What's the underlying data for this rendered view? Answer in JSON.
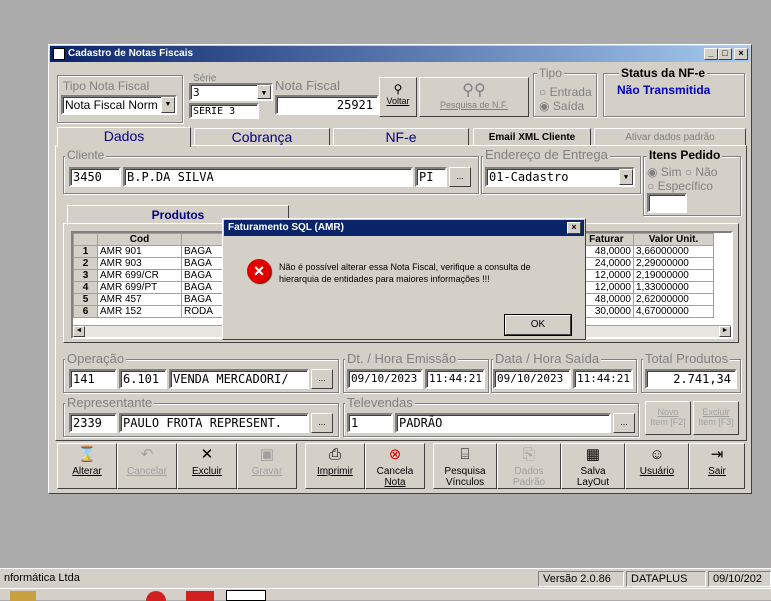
{
  "window": {
    "title": "Cadastro de Notas Fiscais"
  },
  "header": {
    "tipo_label": "Tipo Nota Fiscal",
    "tipo_value": "Nota Fiscal Norm",
    "serie_label": "Série",
    "serie_value": "3",
    "serie_text": "SÉRIE 3",
    "nota_label": "Nota Fiscal",
    "nota_value": "25921",
    "voltar_label": "Voltar",
    "pesquisa_label": "Pesquisa de N.F.",
    "tipo_group_label": "Tipo",
    "entrada_label": "Entrada",
    "saida_label": "Saída",
    "status_label": "Status da NF-e",
    "status_value": "Não Transmitida"
  },
  "tabs": {
    "dados": "Dados",
    "cobranca": "Cobrança",
    "nfe": "NF-e",
    "email": "Email XML Cliente",
    "ativar": "Ativar dados padrão"
  },
  "cliente": {
    "label": "Cliente",
    "code": "3450",
    "name": "B.P.DA SILVA",
    "uf": "PI",
    "ellipsis": "...",
    "endereco_label": "Endereço de Entrega",
    "endereco_value": "01-Cadastro",
    "itens_label": "Itens Pedido",
    "sim": "Sim",
    "nao": "Não",
    "especifico": "Específico"
  },
  "produtos": {
    "tab_label": "Produtos",
    "col_cod": "Cod",
    "col_qtde": "tde Faturar",
    "col_valor": "Valor Unit.",
    "rows": [
      {
        "n": "1",
        "cod": "AMR 901",
        "desc": "BAGA",
        "qtde": "48,0000",
        "valor": "3,66000000"
      },
      {
        "n": "2",
        "cod": "AMR 903",
        "desc": "BAGA",
        "qtde": "24,0000",
        "valor": "2,29000000"
      },
      {
        "n": "3",
        "cod": "AMR 699/CR",
        "desc": "BAGA",
        "qtde": "12,0000",
        "valor": "2,19000000"
      },
      {
        "n": "4",
        "cod": "AMR 699/PT",
        "desc": "BAGA",
        "qtde": "12,0000",
        "valor": "1,33000000"
      },
      {
        "n": "5",
        "cod": "AMR 457",
        "desc": "BAGA",
        "qtde": "48,0000",
        "valor": "2,62000000"
      },
      {
        "n": "6",
        "cod": "AMR 152",
        "desc": "RODA",
        "qtde": "30,0000",
        "valor": "4,67000000"
      }
    ]
  },
  "operacao": {
    "label": "Operação",
    "code": "141",
    "cfop": "6.101",
    "desc": "VENDA MERCADORI/",
    "emissao_label": "Dt. / Hora Emissão",
    "emissao_date": "09/10/2023",
    "emissao_time": "11:44:21",
    "saida_label": "Data / Hora Saída",
    "saida_date": "09/10/2023",
    "saida_time": "11:44:21",
    "total_label": "Total Produtos",
    "total_value": "2.741,34"
  },
  "representante": {
    "label": "Representante",
    "code": "2339",
    "name": "PAULO FROTA REPRESENT.",
    "televendas_label": "Televendas",
    "tele_code": "1",
    "tele_name": "PADRÃO",
    "novo_label": "Novo",
    "novo_key": "Item [F2]",
    "excluir_label": "Excluir",
    "excluir_key": "Item [F3]"
  },
  "toolbar": {
    "alterar": "Alterar",
    "cancelar": "Cancelar",
    "excluir": "Excluir",
    "gravar": "Gravar",
    "imprimir": "Imprimir",
    "cancela_nota_1": "Cancela",
    "cancela_nota_2": "Nota",
    "pesquisa_1": "Pesquisa",
    "pesquisa_2": "Vínculos",
    "dados_1": "Dados",
    "dados_2": "Padrão",
    "salva_1": "Salva",
    "salva_2": "LayOut",
    "usuario": "Usuário",
    "sair": "Sair"
  },
  "dialog": {
    "title": "Faturamento SQL (AMR)",
    "line1": "Não é possível alterar essa Nota Fiscal, verifique a consulta de",
    "line2": "hierarquia de entidades para maiores informações !!!",
    "ok": "OK",
    "close": "×"
  },
  "statusbar": {
    "company": "nformática Ltda",
    "version": "Versão 2.0.86",
    "db": "DATAPLUS",
    "date": "09/10/202"
  }
}
